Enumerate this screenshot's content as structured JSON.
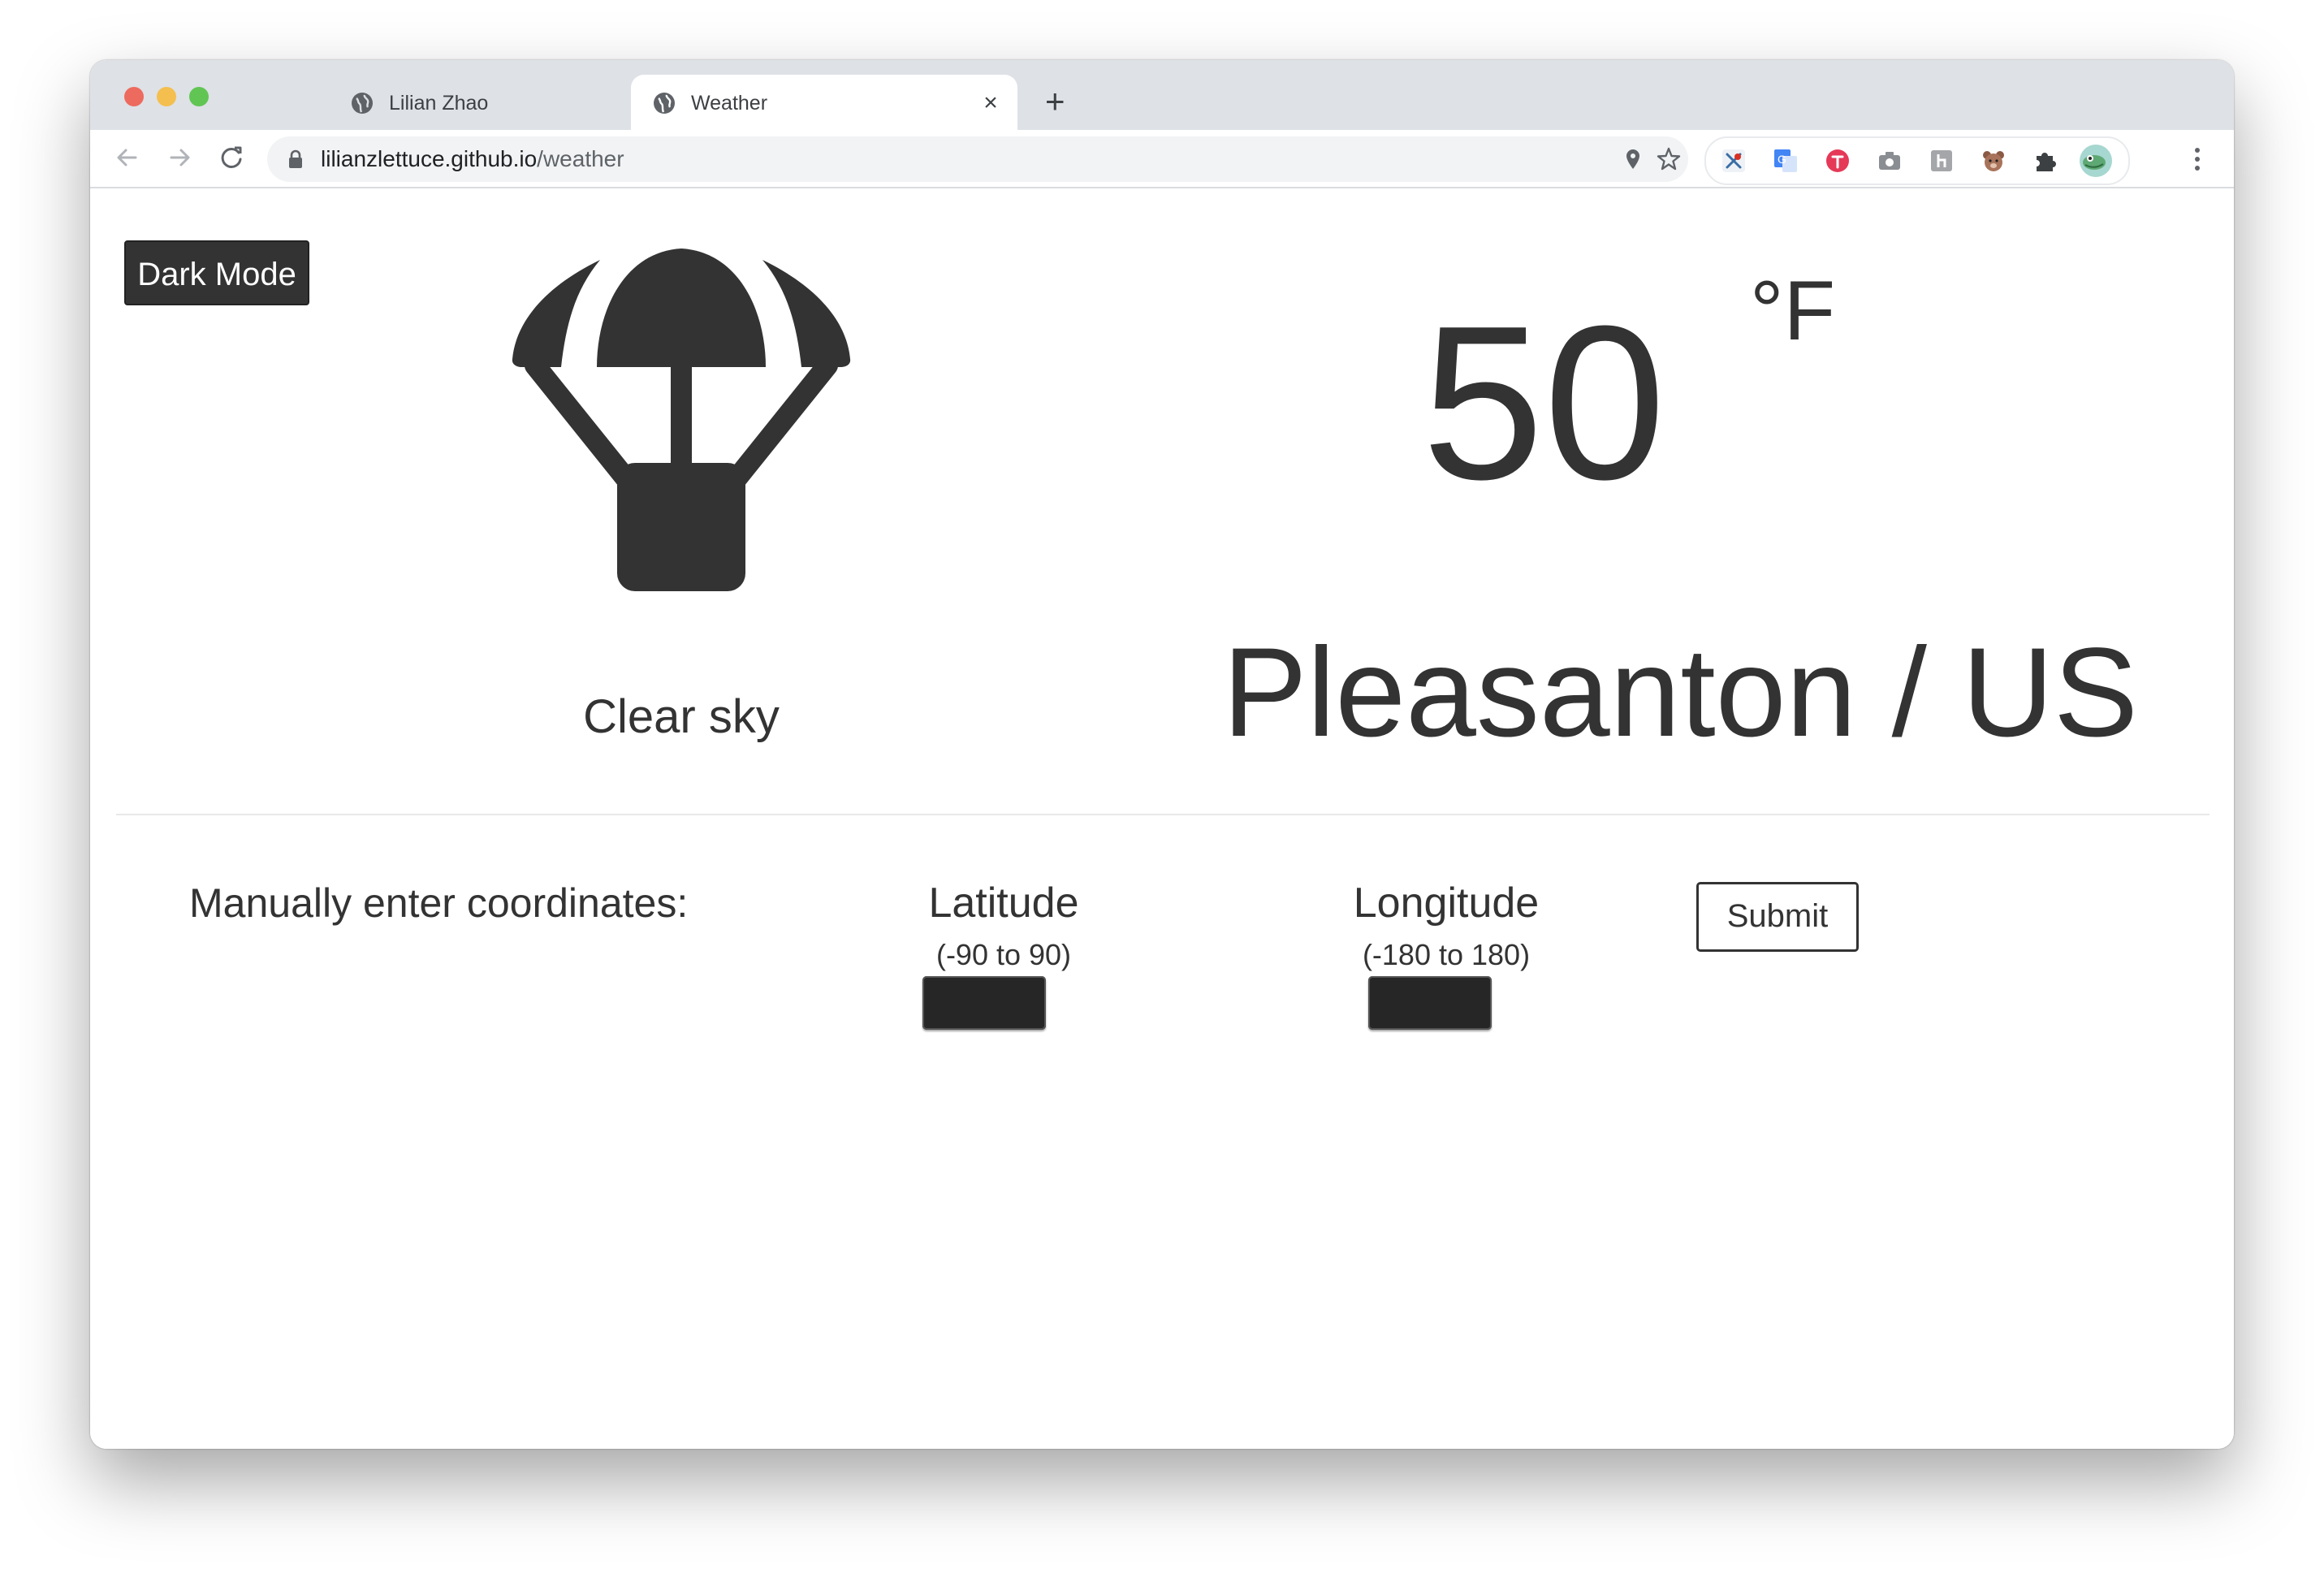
{
  "browser": {
    "tabs": [
      {
        "title": "Lilian Zhao",
        "icon": "globe-icon",
        "active": false
      },
      {
        "title": "Weather",
        "icon": "globe-icon",
        "active": true
      }
    ],
    "url_host": "lilianzlettuce.github.io",
    "url_path": "/weather"
  },
  "page": {
    "dark_mode_label": "Dark Mode",
    "weather_icon": "parachute-icon",
    "condition": "Clear sky",
    "temperature": "50",
    "unit": "°F",
    "location": "Pleasanton / US"
  },
  "coordinates": {
    "prompt": "Manually enter coordinates:",
    "latitude_label": "Latitude",
    "latitude_range": "(-90 to 90)",
    "latitude_value": "",
    "longitude_label": "Longitude",
    "longitude_range": "(-180 to 180)",
    "longitude_value": "",
    "submit_label": "Submit"
  },
  "colors": {
    "text": "#333333",
    "input_fill": "#262626",
    "tabstrip": "#dee1e6"
  }
}
